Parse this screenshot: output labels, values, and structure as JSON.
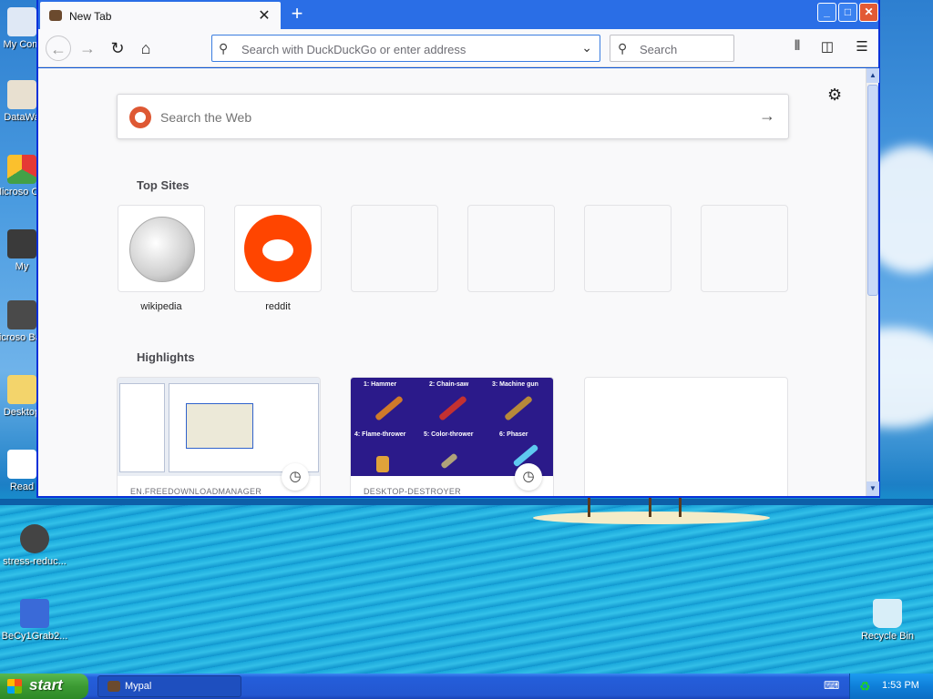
{
  "desktop": {
    "icons": [
      {
        "label": "My Com",
        "icon": "my-computer-icon"
      },
      {
        "label": "DataWa",
        "icon": "shortcut-icon"
      },
      {
        "label": "Microso C++",
        "icon": "visual-cpp-icon"
      },
      {
        "label": "My",
        "icon": "user-icon"
      },
      {
        "label": "Microso Basic",
        "icon": "visual-basic-icon"
      },
      {
        "label": "Desktop",
        "icon": "folder-icon"
      },
      {
        "label": "Read",
        "icon": "document-icon"
      },
      {
        "label": "stress-reduc...",
        "icon": "shortcut-icon"
      },
      {
        "label": "BeCy1Grab2...",
        "icon": "application-icon"
      },
      {
        "label": "Recycle Bin",
        "icon": "recycle-bin-icon"
      }
    ]
  },
  "browser": {
    "tab_title": "New Tab",
    "tab_close": "✕",
    "new_tab": "+",
    "window_buttons": {
      "minimize": "_",
      "maximize": "□",
      "close": "✕"
    },
    "address_placeholder": "Search with DuckDuckGo or enter address",
    "search_placeholder": "Search",
    "content": {
      "web_search_placeholder": "Search the Web",
      "top_sites_title": "Top Sites",
      "top_sites": [
        {
          "label": "wikipedia",
          "icon": "wikipedia-globe-icon"
        },
        {
          "label": "reddit",
          "icon": "reddit-alien-icon"
        }
      ],
      "highlights_title": "Highlights",
      "highlights": [
        {
          "source": "EN.FREEDOWNLOADMANAGER"
        },
        {
          "source": "DESKTOP-DESTROYER"
        }
      ],
      "destroyer_labels": [
        "1: Hammer",
        "2: Chain-saw",
        "3: Machine gun",
        "4: Flame-thrower",
        "5: Color-thrower",
        "6: Phaser"
      ]
    }
  },
  "taskbar": {
    "start_label": "start",
    "tasks": [
      {
        "label": "Mypal"
      }
    ],
    "clock": "1:53 PM"
  },
  "colors": {
    "xp_blue": "#245edb",
    "start_green": "#3c9a33",
    "reddit": "#ff4500",
    "duckduckgo": "#de5833"
  }
}
